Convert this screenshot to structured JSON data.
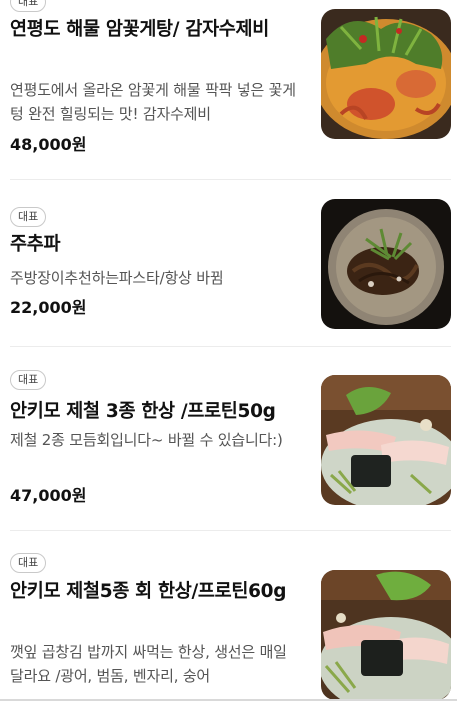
{
  "menu": {
    "items": [
      {
        "badge": "대표",
        "name": "연평도 해물 암꽃게탕/ 감자수제비",
        "description": "연평도에서 올라온 암꽃게 해물 팍팍 넣은 꽃게텅 완전 힐링되는 맛! 감자수제비",
        "price": "48,000원",
        "image_alt": "crab-stew-photo"
      },
      {
        "badge": "대표",
        "name": "주추파",
        "description": "주방장이추천하는파스타/항상 바뀜",
        "price": "22,000원",
        "image_alt": "pasta-photo"
      },
      {
        "badge": "대표",
        "name": "안키모 제철 3종 한상 /프로틴50g",
        "description": "제철 2종 모듬회입니다~ 바뀔 수 있습니다:)",
        "price": "47,000원",
        "image_alt": "sashimi-platter-photo"
      },
      {
        "badge": "대표",
        "name": "안키모 제철5종 회 한상/프로틴60g",
        "description": "깻잎 곱창김 밥까지 싸먹는 한상, 생선은 매일 달라요 /광어, 범돔, 벤자리, 숭어",
        "price": "",
        "image_alt": "sashimi-set-photo"
      }
    ]
  }
}
